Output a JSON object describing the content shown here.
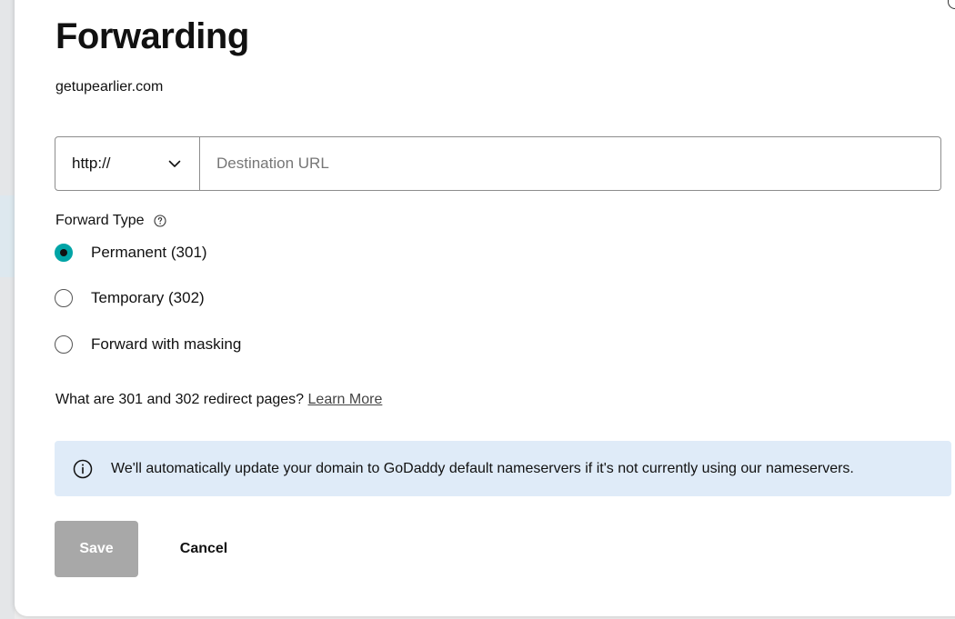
{
  "dialog": {
    "title": "Forwarding",
    "domain": "getupearlier.com"
  },
  "destination": {
    "protocol_value": "http://",
    "url_value": "",
    "url_placeholder": "Destination URL"
  },
  "forward_type": {
    "label": "Forward Type",
    "options": [
      {
        "label": "Permanent (301)",
        "checked": true
      },
      {
        "label": "Temporary (302)",
        "checked": false
      },
      {
        "label": "Forward with masking",
        "checked": false
      }
    ]
  },
  "redirect_info": {
    "question": "What are 301 and 302 redirect pages?",
    "learn_more": "Learn More"
  },
  "banner": {
    "text": "We'll automatically update your domain to GoDaddy default nameservers if it's not currently using our nameservers."
  },
  "actions": {
    "save": "Save",
    "cancel": "Cancel"
  },
  "colors": {
    "radio_selected": "#00a4a6",
    "banner_bg": "#dfebf8",
    "save_disabled_bg": "#a8a8a8"
  },
  "icons": {
    "protocol_dropdown": "chevron-down-icon",
    "forward_type_help": "help-circle-icon",
    "banner": "info-icon",
    "close": "close-icon"
  }
}
